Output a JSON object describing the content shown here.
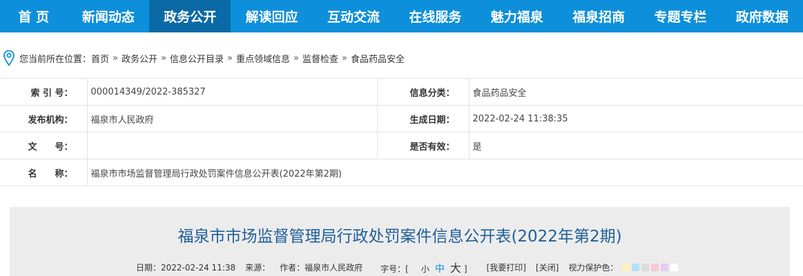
{
  "nav": {
    "items": [
      {
        "label": "首 页"
      },
      {
        "label": "新闻动态"
      },
      {
        "label": "政务公开"
      },
      {
        "label": "解读回应"
      },
      {
        "label": "互动交流"
      },
      {
        "label": "在线服务"
      },
      {
        "label": "魅力福泉"
      },
      {
        "label": "福泉招商"
      },
      {
        "label": "专题专栏"
      },
      {
        "label": "政府数据"
      }
    ],
    "active_index": 2,
    "colors": {
      "bar": "#0d8fdb",
      "active": "#0a6aa6"
    }
  },
  "breadcrumb": {
    "prefix": "您当前所在位置：",
    "items": [
      "首页",
      "政务公开",
      "信息公开目录",
      "重点领域信息",
      "监督检查",
      "食品药品安全"
    ],
    "separator": "»"
  },
  "info": {
    "index_label": "索 引 号：",
    "index_value": "000014349/2022-385327",
    "category_label": "信息分类：",
    "category_value": "食品药品安全",
    "publisher_label": "发布机构：",
    "publisher_value": "福泉市人民政府",
    "date_label": "生成日期：",
    "date_value": "2022-02-24 11:38:35",
    "docno_label": "文　　号：",
    "docno_value": "",
    "valid_label": "是否有效：",
    "valid_value": "是",
    "name_label": "名　　称：",
    "name_value": "福泉市市场监督管理局行政处罚案件信息公开表(2022年第2期)"
  },
  "article": {
    "title": "福泉市市场监督管理局行政处罚案件信息公开表(2022年第2期)",
    "date": "日期：2022-02-24 11:38",
    "source": "来源：",
    "author": "作者：福泉市人民政府",
    "font_prefix": "字号：[",
    "font_small": "小",
    "font_mid": "中",
    "font_big": "大",
    "font_suffix": "]",
    "print": "[我要打印]",
    "close": "[关闭]",
    "eye_label": "视力保护色：",
    "swatches": [
      "#fbf3b8",
      "#b8e0f5",
      "#dcdcdc",
      "#f7c8d4",
      "#e2cdf2",
      "#ffffff"
    ]
  }
}
